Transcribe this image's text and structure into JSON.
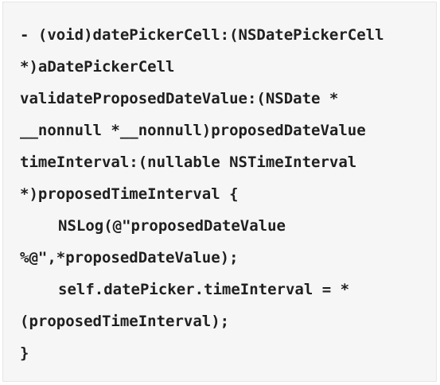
{
  "code": {
    "lines": [
      "- (void)datePickerCell:(NSDatePickerCell",
      "*)aDatePickerCell",
      "validateProposedDateValue:(NSDate *",
      "__nonnull *__nonnull)proposedDateValue",
      "timeInterval:(nullable NSTimeInterval",
      "*)proposedTimeInterval {",
      "NSLog(@\"proposedDateValue",
      "%@\",*proposedDateValue);",
      "self.datePicker.timeInterval = *",
      "(proposedTimeInterval);",
      "}"
    ]
  }
}
